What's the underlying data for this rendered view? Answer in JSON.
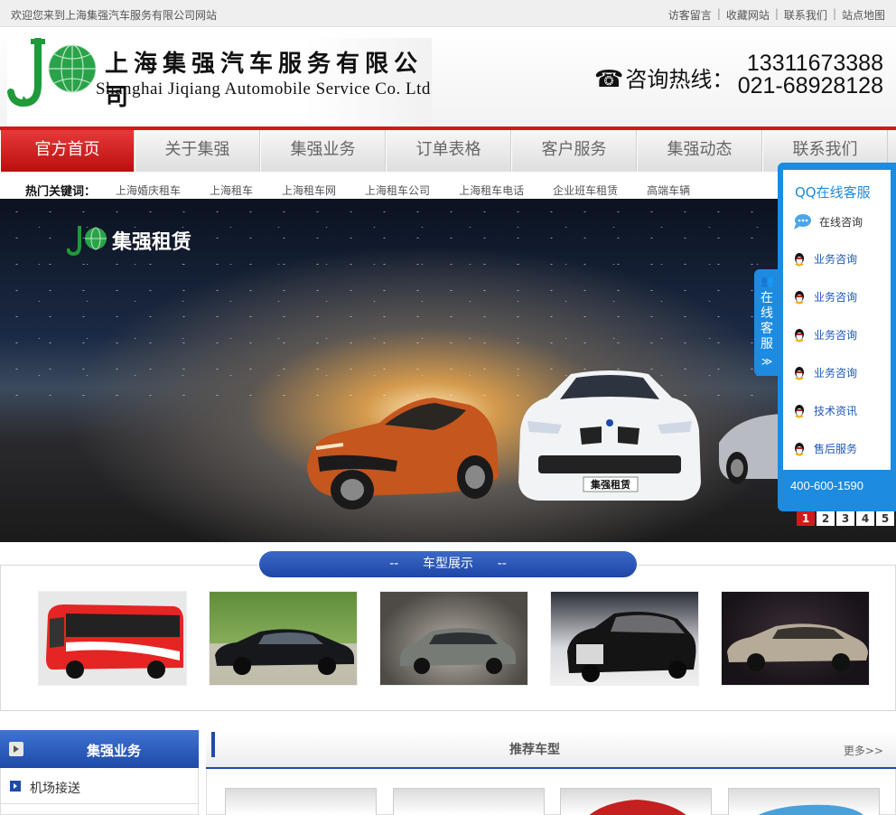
{
  "topbar": {
    "welcome": "欢迎您来到上海集强汽车服务有限公司网站",
    "links": [
      "访客留言",
      "收藏网站",
      "联系我们",
      "站点地图"
    ]
  },
  "header": {
    "logo_cn": "上海集强汽车服务有限公司",
    "logo_en": "Shanghai Jiqiang Automobile Service Co. Ltd",
    "hotline_label": "咨询热线：",
    "phone_1": "13311673388",
    "phone_2": "021-68928128"
  },
  "nav": {
    "items": [
      "官方首页",
      "关于集强",
      "集强业务",
      "订单表格",
      "客户服务",
      "集强动态",
      "联系我们"
    ],
    "active_index": 0
  },
  "keywords": {
    "label": "热门关键词：",
    "items": [
      "上海婚庆租车",
      "上海租车",
      "上海租车网",
      "上海租车公司",
      "上海租车电话",
      "企业班车租赁",
      "高端车辆"
    ]
  },
  "banner": {
    "brand": "集强租赁",
    "plate": "集强租赁",
    "pages": [
      "1",
      "2",
      "3",
      "4",
      "5"
    ],
    "current_page": "1"
  },
  "models": {
    "title": "--      车型展示      --"
  },
  "sidebar": {
    "title": "集强业务",
    "items": [
      "机场接送"
    ]
  },
  "recommended": {
    "title": "推荐车型",
    "more": "更多>>"
  },
  "qq": {
    "tab_text": "在线客服",
    "tab_arrow": "≫",
    "title": "QQ在线客服",
    "rows": [
      "在线咨询",
      "业务咨询",
      "业务咨询",
      "业务咨询",
      "业务咨询",
      "技术资讯",
      "售后服务"
    ],
    "phone": "400-600-1590"
  },
  "colors": {
    "brand_red": "#d21a1a",
    "brand_blue": "#1e4aa8",
    "qq_blue": "#1d8be0"
  }
}
